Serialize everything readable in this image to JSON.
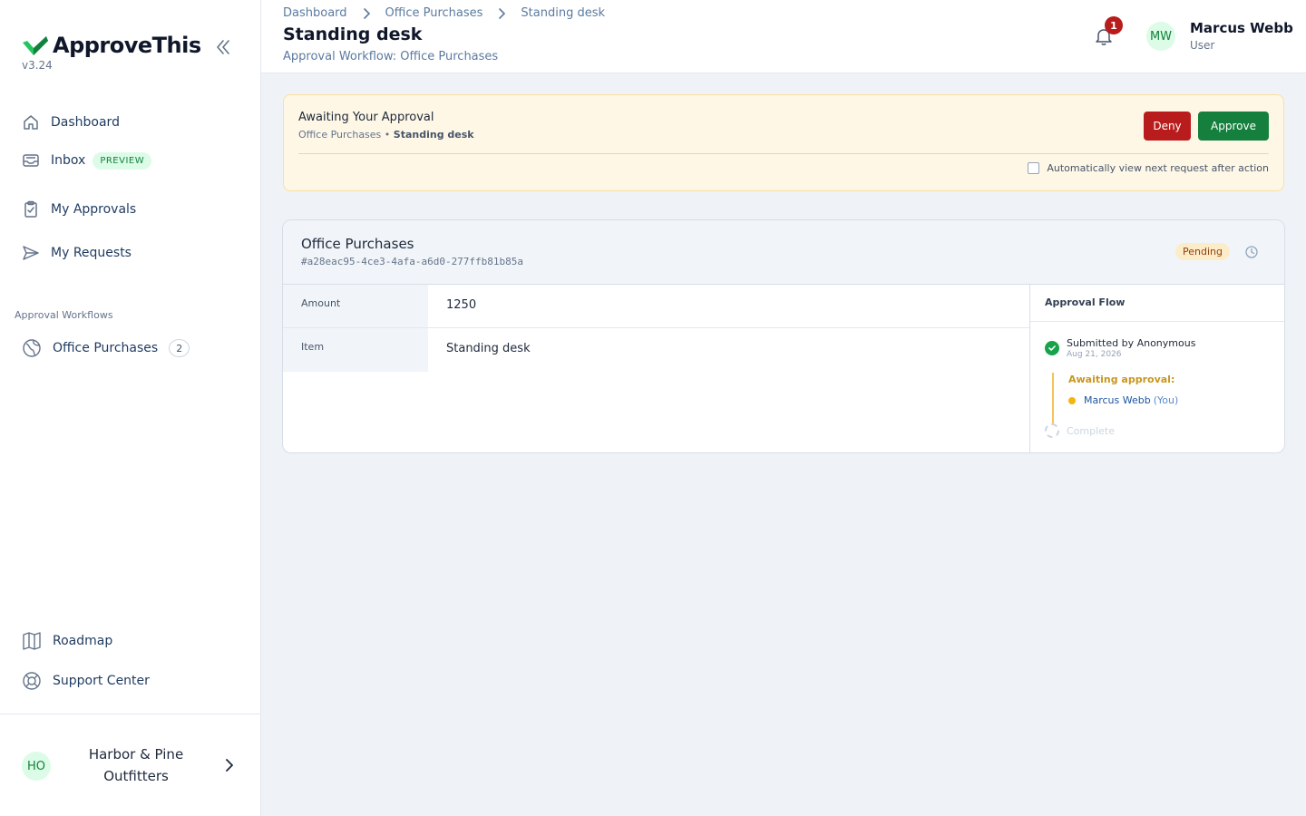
{
  "app": {
    "name": "ApproveThis",
    "version": "v3.24"
  },
  "sidebar": {
    "items": [
      {
        "label": "Dashboard",
        "icon": "home-icon"
      },
      {
        "label": "Inbox",
        "badge": "PREVIEW",
        "icon": "inbox-icon"
      },
      {
        "label": "My Approvals",
        "icon": "clipboard-check-icon"
      },
      {
        "label": "My Requests",
        "icon": "send-icon"
      }
    ],
    "section_label": "Approval Workflows",
    "workflows": [
      {
        "label": "Office Purchases",
        "count": "2",
        "icon": "globe-icon"
      }
    ],
    "bottom_items": [
      {
        "label": "Roadmap",
        "icon": "map-icon"
      },
      {
        "label": "Support Center",
        "icon": "lifebuoy-icon"
      }
    ],
    "org": {
      "initials": "HO",
      "name": "Harbor & Pine Outfitters"
    }
  },
  "header": {
    "breadcrumb": [
      "Dashboard",
      "Office Purchases",
      "Standing desk"
    ],
    "title": "Standing desk",
    "subtitle": "Approval Workflow: Office Purchases",
    "notifications": "1",
    "user": {
      "initials": "MW",
      "name": "Marcus Webb",
      "role": "User"
    }
  },
  "banner": {
    "title": "Awaiting Your Approval",
    "sub_workflow": "Office Purchases",
    "sub_separator": "•",
    "sub_item": "Standing desk",
    "deny_label": "Deny",
    "approve_label": "Approve",
    "auto_label": "Automatically view next request after action",
    "auto_checked": false
  },
  "request": {
    "workflow": "Office Purchases",
    "id": "#a28eac95-4ce3-4afa-a6d0-277ffb81b85a",
    "status": "Pending",
    "fields": [
      {
        "label": "Amount",
        "value": "1250"
      },
      {
        "label": "Item",
        "value": "Standing desk"
      }
    ],
    "flow": {
      "heading": "Approval Flow",
      "submitted": "Submitted by Anonymous",
      "date": "Aug 21, 2026",
      "awaiting": "Awaiting approval:",
      "approver": "Marcus Webb",
      "approver_suffix": "(You)",
      "complete": "Complete"
    }
  },
  "colors": {
    "brand": "#15803d",
    "deny": "#b91c1c",
    "pending": "#fdecc8",
    "banner": "#fef7e6"
  }
}
